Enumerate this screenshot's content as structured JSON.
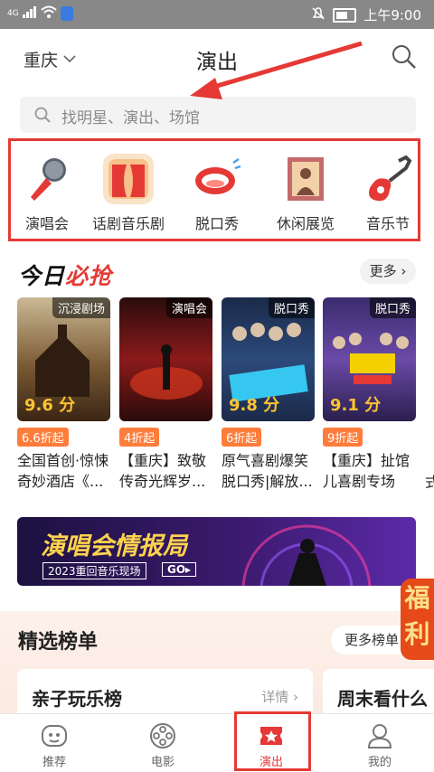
{
  "status_bar": {
    "signal": "4G",
    "time": "上午9:00"
  },
  "header": {
    "city": "重庆",
    "title": "演出"
  },
  "search": {
    "placeholder": "找明星、演出、场馆"
  },
  "categories": [
    {
      "label": "演唱会",
      "icon": "microphone-icon"
    },
    {
      "label": "话剧音乐剧",
      "icon": "stage-curtain-icon"
    },
    {
      "label": "脱口秀",
      "icon": "mouth-icon"
    },
    {
      "label": "休闲展览",
      "icon": "painting-frame-icon"
    },
    {
      "label": "音乐节",
      "icon": "guitar-icon"
    }
  ],
  "today": {
    "title_part1": "今日",
    "title_part2": "必抢",
    "more_label": "更多 ›",
    "items": [
      {
        "tag": "沉浸剧场",
        "score": "9.6 分",
        "discount": "6.6折起",
        "title": "全国首创·惊悚奇妙酒店《..."
      },
      {
        "tag": "演唱会",
        "score": "",
        "discount": "4折起",
        "title": "【重庆】致敬传奇光辉岁..."
      },
      {
        "tag": "脱口秀",
        "score": "9.8 分",
        "discount": "6折起",
        "title": "原气喜剧爆笑脱口秀|解放..."
      },
      {
        "tag": "脱口秀",
        "score": "9.1 分",
        "discount": "9折起",
        "title": "【重庆】扯馆儿喜剧专场—..."
      }
    ],
    "edge_text": "式"
  },
  "banner": {
    "title": "演唱会情报局",
    "subtitle": "2023重回音乐现场",
    "go": "GO▸"
  },
  "float_badge": {
    "text": "福利"
  },
  "rank": {
    "title": "精选榜单",
    "more_label": "更多榜单",
    "cards": [
      {
        "name": "亲子玩乐榜",
        "detail": "详情 ›"
      },
      {
        "name": "周末看什么"
      }
    ]
  },
  "tabbar": {
    "items": [
      {
        "label": "推荐",
        "icon": "face-icon"
      },
      {
        "label": "电影",
        "icon": "film-reel-icon"
      },
      {
        "label": "演出",
        "icon": "ticket-star-icon"
      },
      {
        "label": "我的",
        "icon": "user-icon"
      }
    ]
  },
  "colors": {
    "accent": "#e53935",
    "discount": "#ff7d3b",
    "score": "#ffc233"
  }
}
